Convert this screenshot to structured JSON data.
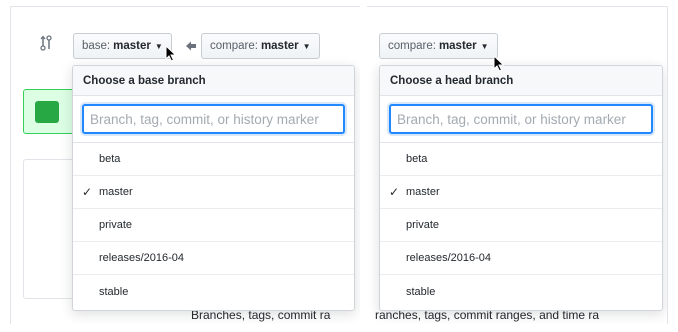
{
  "colors": {
    "accent": "#2188ff",
    "header_bg": "#f6f8fa",
    "green_banner": "#dcffe4",
    "green_icon": "#28a745"
  },
  "left": {
    "compare_icon": "git-compare-icon",
    "base_button": {
      "label": "base:",
      "value": "master"
    },
    "arrow_icon": "arrow-left-icon",
    "compare_button": {
      "label": "compare:",
      "value": "master"
    },
    "dropdown": {
      "header": "Choose a base branch",
      "placeholder": "Branch, tag, commit, or history marker",
      "items": [
        {
          "label": "beta",
          "selected": false
        },
        {
          "label": "master",
          "selected": true
        },
        {
          "label": "private",
          "selected": false
        },
        {
          "label": "releases/2016-04",
          "selected": false
        },
        {
          "label": "stable",
          "selected": false
        }
      ]
    },
    "bottom_text": "Branches, tags, commit ra",
    "side_char": "I"
  },
  "right": {
    "compare_button": {
      "label": "compare:",
      "value": "master"
    },
    "dropdown": {
      "header": "Choose a head branch",
      "placeholder": "Branch, tag, commit, or history marker",
      "items": [
        {
          "label": "beta",
          "selected": false
        },
        {
          "label": "master",
          "selected": true
        },
        {
          "label": "private",
          "selected": false
        },
        {
          "label": "releases/2016-04",
          "selected": false
        },
        {
          "label": "stable",
          "selected": false
        }
      ]
    },
    "bottom_text": "ranches, tags, commit ranges, and time ra"
  },
  "check_glyph": "✓",
  "caret_glyph": "▼"
}
